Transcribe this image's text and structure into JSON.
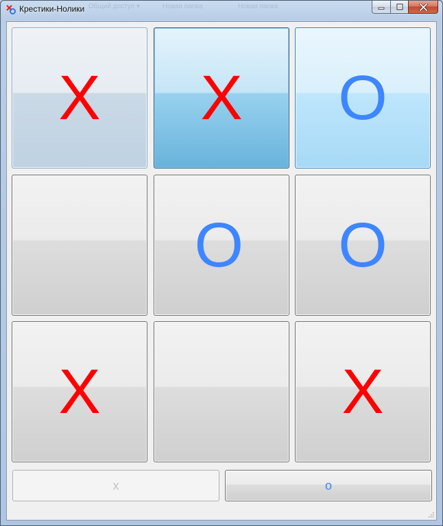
{
  "window": {
    "title": "Крестики-Нолики",
    "background_menu": [
      "Общий доступ ▾",
      "Новая папка",
      "Новая папка"
    ]
  },
  "board": {
    "cells": [
      {
        "mark": "X",
        "state": "hover-faded"
      },
      {
        "mark": "X",
        "state": "pressed"
      },
      {
        "mark": "O",
        "state": "hover"
      },
      {
        "mark": "",
        "state": "normal"
      },
      {
        "mark": "O",
        "state": "normal"
      },
      {
        "mark": "O",
        "state": "normal"
      },
      {
        "mark": "X",
        "state": "normal"
      },
      {
        "mark": "",
        "state": "normal"
      },
      {
        "mark": "X",
        "state": "normal"
      }
    ]
  },
  "players": {
    "x_label": "x",
    "o_label": "o",
    "x_enabled": false,
    "o_enabled": true
  },
  "colors": {
    "x_mark": "#ff0000",
    "o_mark": "#3d86ff",
    "pressed_accent": "#68b3db"
  }
}
